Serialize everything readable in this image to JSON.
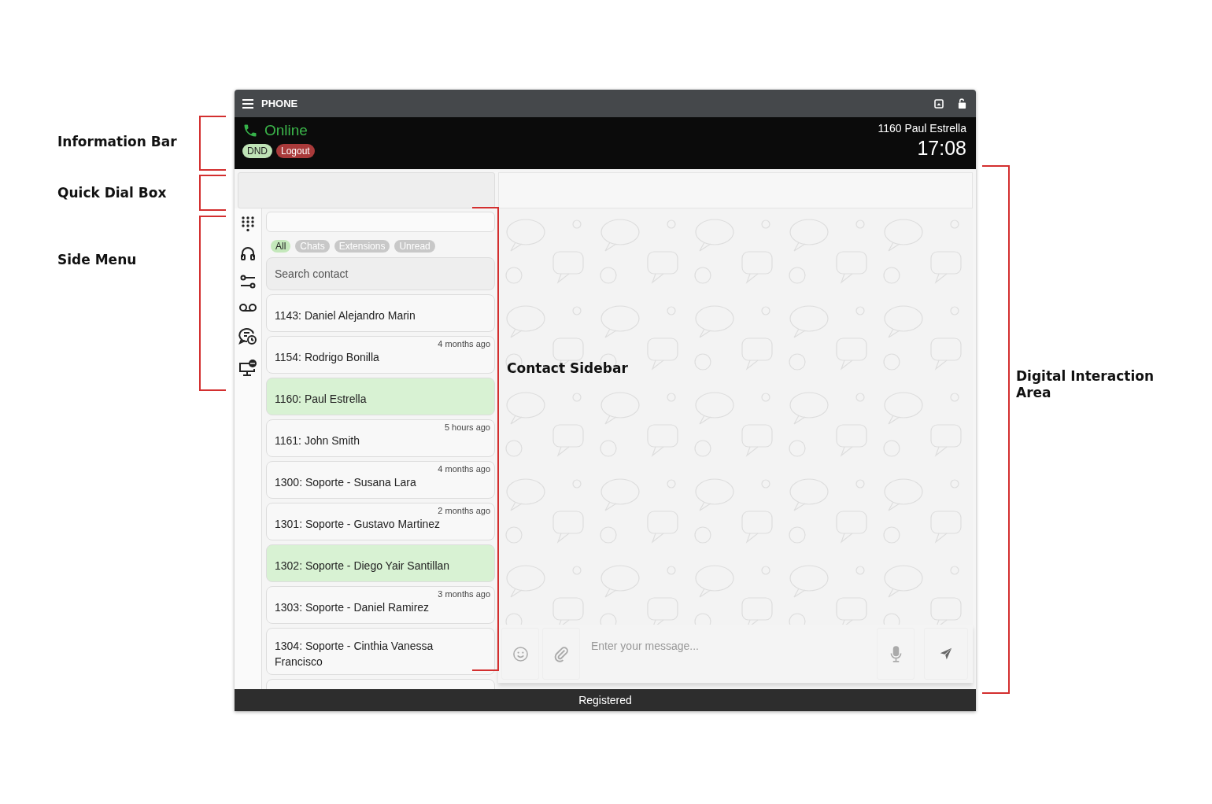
{
  "annotations": [
    {
      "label": "Information Bar"
    },
    {
      "label": "Quick Dial Box"
    },
    {
      "label": "Side Menu"
    },
    {
      "label": "Contact Sidebar"
    },
    {
      "label": "Digital Interaction Area"
    }
  ],
  "title_bar": {
    "title": "PHONE"
  },
  "info_bar": {
    "status": "Online",
    "dnd": "DND",
    "logout": "Logout",
    "user": "1160 Paul Estrella",
    "time": "17:08"
  },
  "contacts": {
    "filters": [
      {
        "label": "All",
        "selected": true
      },
      {
        "label": "Chats",
        "selected": false
      },
      {
        "label": "Extensions",
        "selected": false
      },
      {
        "label": "Unread",
        "selected": false
      }
    ],
    "search": {
      "placeholder": "Search contact"
    },
    "items": [
      {
        "name": "1143: Daniel Alejandro Marin",
        "selected": false
      },
      {
        "name": "1154: Rodrigo Bonilla",
        "time": "4 months ago",
        "selected": false
      },
      {
        "name": "1160: Paul Estrella",
        "selected": true
      },
      {
        "name": "1161: John Smith",
        "time": "5 hours ago",
        "selected": false
      },
      {
        "name": "1300: Soporte - Susana Lara",
        "time": "4 months ago",
        "selected": false
      },
      {
        "name": "1301: Soporte - Gustavo Martinez",
        "time": "2 months ago",
        "selected": false
      },
      {
        "name": "1302: Soporte - Diego Yair Santillan",
        "selected": true
      },
      {
        "name": "1303: Soporte - Daniel Ramirez",
        "time": "3 months ago",
        "selected": false
      },
      {
        "name": "1304: Soporte - Cinthia Vanessa Francisco",
        "selected": false
      }
    ]
  },
  "composer": {
    "placeholder": "Enter your message..."
  },
  "status_bar": {
    "text": "Registered"
  }
}
